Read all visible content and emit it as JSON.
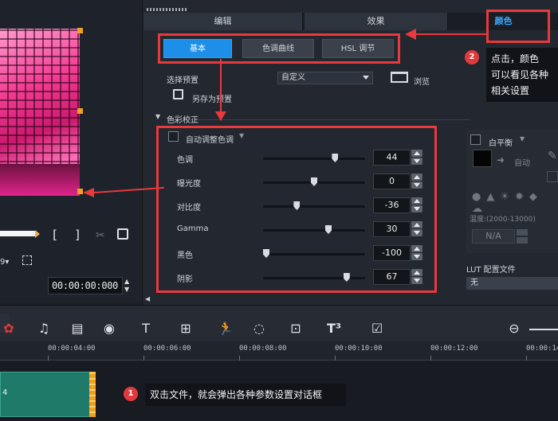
{
  "tabs": {
    "edit": "编辑",
    "effect": "效果",
    "color": "颜色"
  },
  "sub_tabs": {
    "basic": "基本",
    "curve": "色调曲线",
    "hsl": "HSL 调节"
  },
  "preset": {
    "label": "选择预置",
    "value": "自定义",
    "browse": "浏览",
    "save_as": "另存为预置"
  },
  "color_correction": {
    "title": "色彩校正",
    "auto_label": "自动调整色调",
    "rows": [
      {
        "label": "色调",
        "value": "44",
        "fraction": 0.72
      },
      {
        "label": "曝光度",
        "value": "0",
        "fraction": 0.5
      },
      {
        "label": "对比度",
        "value": "-36",
        "fraction": 0.32
      },
      {
        "label": "Gamma",
        "value": "30",
        "fraction": 0.65
      },
      {
        "label": "黑色",
        "value": "-100",
        "fraction": 0.0
      },
      {
        "label": "阴影",
        "value": "67",
        "fraction": 0.84
      }
    ]
  },
  "white_balance": {
    "label": "白平衡",
    "auto": "自动",
    "temperature": "温度:(2000-13000)",
    "temp_value": "N/A"
  },
  "lut": {
    "label": "LUT 配置文件",
    "value": "无"
  },
  "timecode": "00:00:00:000",
  "timeline": {
    "ticks": [
      "00:00:04:00",
      "00:00:06:00",
      "00:00:08:00",
      "00:00:10:00",
      "00:00:12:00",
      "00:00:14"
    ],
    "clip_label": "4"
  },
  "annotations": {
    "badge1": "1",
    "callout1": "双击文件，就会弹出各种参数设置对话框",
    "badge2": "2",
    "callout2_lines": [
      "点击，颜色",
      "可以看见各种",
      "相关设置"
    ]
  },
  "colors": {
    "accent": "#1e8fe8",
    "highlight_red": "#e8393c",
    "clip_green": "#1f7a6a"
  }
}
